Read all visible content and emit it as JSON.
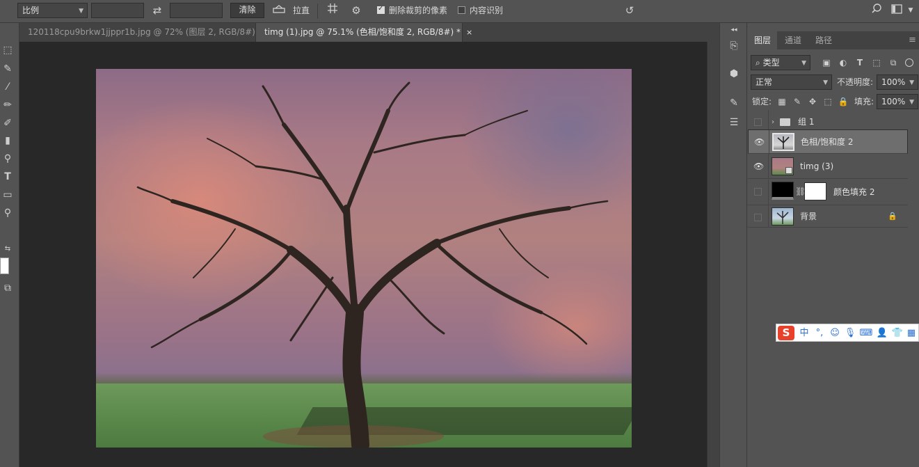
{
  "options_bar": {
    "ratio_select": "比例",
    "clear_button": "清除",
    "straighten_label": "拉直",
    "delete_cropped_pixels": {
      "label": "删除裁剪的像素",
      "checked": true
    },
    "content_aware": {
      "label": "内容识别",
      "checked": false
    }
  },
  "document_tabs": [
    {
      "label": "120118cpu9brkw1jjppr1b.jpg @ 72% (图层 2, RGB/8#) *",
      "active": false
    },
    {
      "label": "timg (1).jpg @ 75.1% (色相/饱和度 2, RGB/8#) *",
      "active": true
    }
  ],
  "tab_close_glyph": "×",
  "layers_panel": {
    "tabs": [
      {
        "label": "图层",
        "active": true
      },
      {
        "label": "通道",
        "active": false
      },
      {
        "label": "路径",
        "active": false
      }
    ],
    "filter_kind": "类型",
    "blend_mode": "正常",
    "opacity_label": "不透明度:",
    "opacity_value": "100%",
    "lock_label": "锁定:",
    "fill_label": "填充:",
    "fill_value": "100%",
    "layers": [
      {
        "name": "组 1",
        "visible": false,
        "type": "group",
        "selected": false
      },
      {
        "name": "色相/饱和度 2",
        "visible": true,
        "type": "adjustment",
        "selected": true
      },
      {
        "name": "timg (3)",
        "visible": true,
        "type": "smart-object",
        "selected": false
      },
      {
        "name": "颜色填充 2",
        "visible": false,
        "type": "fill",
        "selected": false
      },
      {
        "name": "背景",
        "visible": false,
        "type": "background",
        "selected": false,
        "locked": true
      }
    ]
  },
  "ime_bar": {
    "logo": "S",
    "mode": "中",
    "punct": "°,"
  },
  "colors": {
    "ui_bg": "#535353",
    "canvas_bg": "#282828",
    "tab_bg": "#424242",
    "selected_layer": "#6e6e6e",
    "ime_red": "#e8412b",
    "ime_blue": "#2a6fd1"
  }
}
